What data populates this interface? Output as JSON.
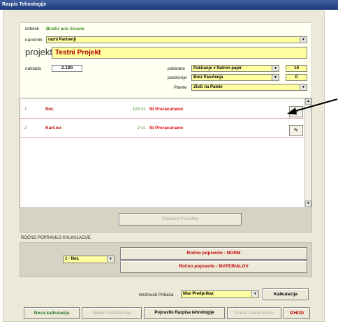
{
  "window": {
    "title": "Razpis Tehnologije"
  },
  "form": {
    "izdelek_label": "izdelek",
    "izdelek_value": "Brošir ano šivano",
    "narocnik_label": "naročnik",
    "narocnik_value": "razni Partnerji",
    "projekt_label": "projekt",
    "projekt_value": "Testni Projekt",
    "naklada_label": "naklada",
    "naklada_value": "2.100",
    "pakirane_label": "pakirane",
    "pakirane_value": "Pakiranje v Natron papir",
    "pakirane_qty": "10",
    "pasicenje_label": "pasičenje",
    "pasicenje_value": "Brez Pasičenja",
    "pasicenje_qty": "0",
    "palete_label": "Palete",
    "palete_value": "Zloži na Palete"
  },
  "list": {
    "rows": [
      {
        "num": "1",
        "name": "Not.",
        "qty": "100 st.",
        "status": "Ni Preracunano"
      },
      {
        "num": "2",
        "name": "Kart.ov.",
        "qty": "2 st.",
        "status": "Ni Preracunano"
      }
    ]
  },
  "actions": {
    "izdelava_label": "Izdelava Ponudbe"
  },
  "manual": {
    "section_title": "ROČNO POPRAVILO KALKULACIJE",
    "select_value": "1 - Not.",
    "norm_button": "Ročno popravilo - NORM",
    "material_button": "Ročno popravilo - MATERIALOV"
  },
  "preview": {
    "label": "Možnosti Prikaza",
    "select_value": "Max Predprikaz",
    "kalkulacija_button": "Kalkulacija"
  },
  "toolbar": {
    "nova": "Nova kalkulacija",
    "meniji": "Meniji Vzdrževanja",
    "popravilo": "Popravilo Razpisa tehnologije",
    "prikaz": "Prikaz Dokumentov",
    "izhod": "IZHOD"
  }
}
